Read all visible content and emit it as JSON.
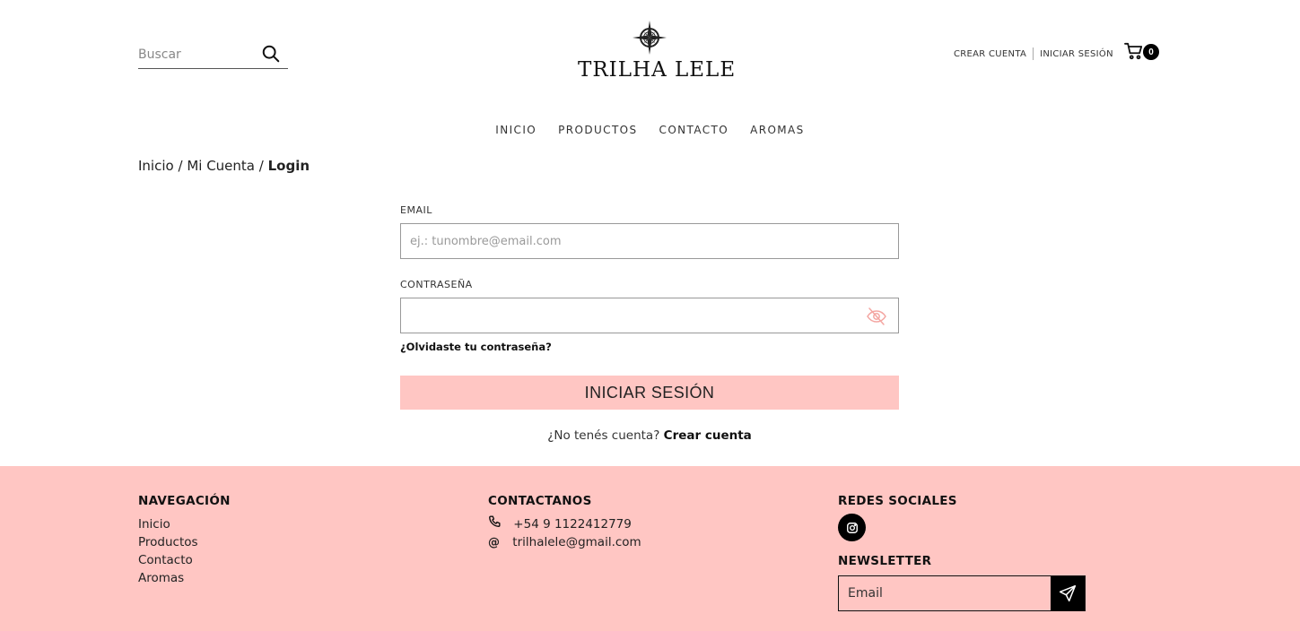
{
  "header": {
    "search_placeholder": "Buscar",
    "logo_text": "TRILHA LELE",
    "create_account": "CREAR CUENTA",
    "login": "INICIAR SESIÓN",
    "cart_count": "0"
  },
  "nav": {
    "items": [
      "INICIO",
      "PRODUCTOS",
      "CONTACTO",
      "AROMAS"
    ]
  },
  "breadcrumb": {
    "home": "Inicio",
    "sep": "/",
    "account": "Mi Cuenta",
    "current": "Login"
  },
  "form": {
    "email_label": "EMAIL",
    "email_placeholder": "ej.: tunombre@email.com",
    "password_label": "CONTRASEÑA",
    "forgot": "¿Olvidaste tu contraseña?",
    "submit": "INICIAR SESIÓN",
    "no_account": "¿No tenés cuenta?",
    "create_account": "Crear cuenta"
  },
  "footer": {
    "nav_title": "NAVEGACIÓN",
    "nav_links": [
      "Inicio",
      "Productos",
      "Contacto",
      "Aromas"
    ],
    "contact_title": "CONTACTANOS",
    "phone": "+54 9 1122412779",
    "email": "trilhalele@gmail.com",
    "social_title": "REDES SOCIALES",
    "social_icons": [
      "instagram-icon"
    ],
    "newsletter_title": "NEWSLETTER",
    "newsletter_placeholder": "Email"
  },
  "colors": {
    "accent_pink": "#ffc6c3",
    "text": "#1a1a1a",
    "black": "#000000"
  }
}
